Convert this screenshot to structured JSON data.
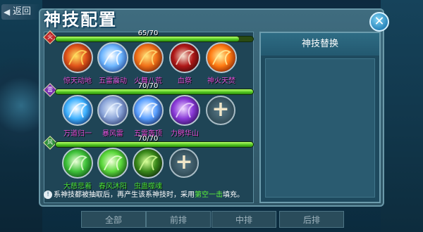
{
  "nav": {
    "back_label": "返回"
  },
  "dialog": {
    "title": "神技配置",
    "close_symbol": "✕"
  },
  "right_panel": {
    "title": "神技替换"
  },
  "groups": [
    {
      "badge": "火",
      "badge_color": "#c0282a",
      "progress_text": "65/70",
      "progress": 0.93,
      "skills": [
        {
          "name": "惊天动地",
          "icon": "fire-swirl-icon",
          "color": "#e04fd7"
        },
        {
          "name": "五雷震动",
          "icon": "thunder-fist-icon",
          "color": "#e04fd7"
        },
        {
          "name": "火舞八荒",
          "icon": "fire-ring-icon",
          "color": "#e04fd7"
        },
        {
          "name": "血祭",
          "icon": "blood-slash-icon",
          "color": "#e04fd7"
        },
        {
          "name": "神火天焚",
          "icon": "fireball-icon",
          "color": "#e04fd7"
        }
      ]
    },
    {
      "badge": "雷",
      "badge_color": "#7a2fb0",
      "progress_text": "70/70",
      "progress": 1.0,
      "skills": [
        {
          "name": "万道归一",
          "icon": "energy-orb-icon",
          "color": "#e04fd7"
        },
        {
          "name": "暴风雷",
          "icon": "storm-vortex-icon",
          "color": "#e04fd7"
        },
        {
          "name": "五雷轰顶",
          "icon": "lightning-strike-icon",
          "color": "#e04fd7"
        },
        {
          "name": "力劈华山",
          "icon": "purple-slash-icon",
          "color": "#e04fd7"
        }
      ]
    },
    {
      "badge": "风",
      "badge_color": "#2f8f3a",
      "progress_text": "70/70",
      "progress": 1.0,
      "skills": [
        {
          "name": "大慈悲着",
          "icon": "green-shield-icon",
          "color": "#4be03a"
        },
        {
          "name": "春风沐阳",
          "icon": "green-figure-icon",
          "color": "#4be03a"
        },
        {
          "name": "虫蛊噬魂",
          "icon": "spider-icon",
          "color": "#4be03a"
        }
      ]
    }
  ],
  "note": {
    "prefix": "系神技都被抽取后，再产生该系神技时，采用",
    "highlight": "第空一击",
    "suffix": "填充。",
    "info_symbol": "!"
  },
  "bottom_tabs": [
    "全部",
    "前排",
    "中排",
    "后排"
  ]
}
